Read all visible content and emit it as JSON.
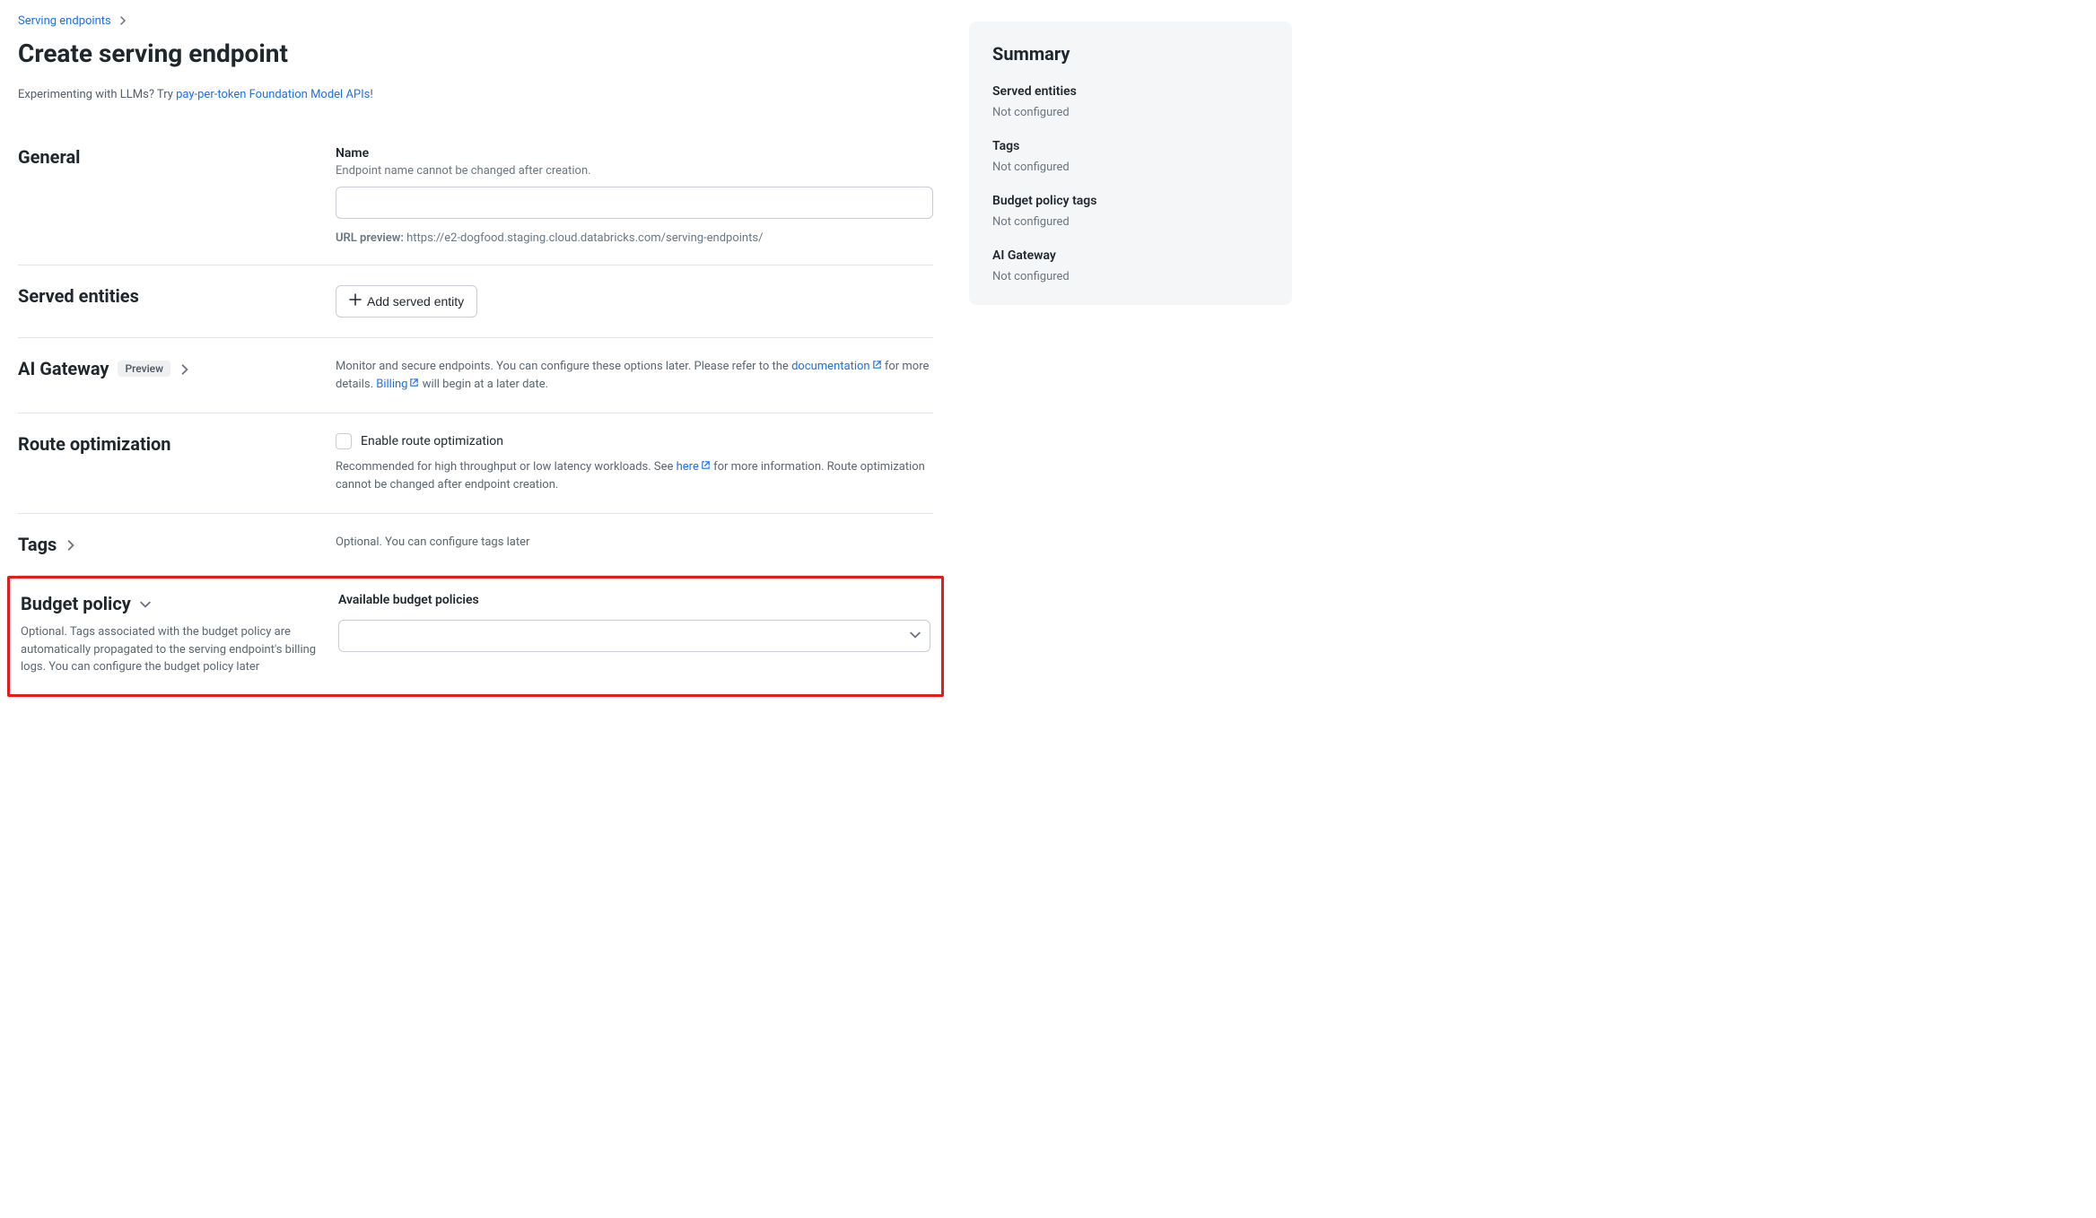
{
  "breadcrumb": {
    "parent": "Serving endpoints"
  },
  "page_title": "Create serving endpoint",
  "hint": {
    "prefix": "Experimenting with LLMs? Try ",
    "link": "pay-per-token Foundation Model APIs",
    "suffix": "!"
  },
  "general": {
    "title": "General",
    "name_label": "Name",
    "name_hint": "Endpoint name cannot be changed after creation.",
    "name_value": "",
    "url_preview_label": "URL preview:",
    "url_preview_value": "https://e2-dogfood.staging.cloud.databricks.com/serving-endpoints/"
  },
  "served_entities": {
    "title": "Served entities",
    "add_button": "Add served entity"
  },
  "ai_gateway": {
    "title": "AI Gateway",
    "badge": "Preview",
    "text_before": "Monitor and secure endpoints. You can configure these options later. Please refer to the ",
    "doc_link": "documentation",
    "text_mid": " for more details. ",
    "billing_link": "Billing",
    "text_after": " will begin at a later date."
  },
  "route_opt": {
    "title": "Route optimization",
    "checkbox_label": "Enable route optimization",
    "text_before": "Recommended for high throughput or low latency workloads. See ",
    "here_link": "here",
    "text_after": " for more information. Route optimization cannot be changed after endpoint creation."
  },
  "tags": {
    "title": "Tags",
    "text": "Optional. You can configure tags later"
  },
  "budget_policy": {
    "title": "Budget policy",
    "subtext": "Optional. Tags associated with the budget policy are automatically propagated to the serving endpoint's billing logs. You can configure the budget policy later",
    "field_label": "Available budget policies",
    "selected": ""
  },
  "summary": {
    "title": "Summary",
    "items": [
      {
        "label": "Served entities",
        "value": "Not configured"
      },
      {
        "label": "Tags",
        "value": "Not configured"
      },
      {
        "label": "Budget policy tags",
        "value": "Not configured"
      },
      {
        "label": "AI Gateway",
        "value": "Not configured"
      }
    ]
  }
}
